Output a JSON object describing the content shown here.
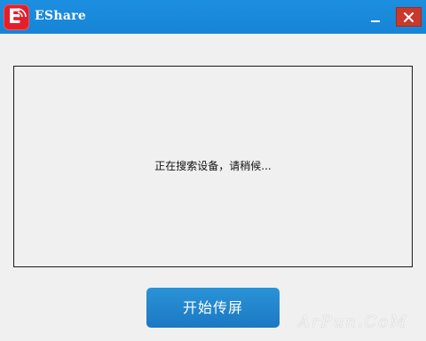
{
  "window": {
    "title": "EShare",
    "app_icon_letter": "E"
  },
  "titlebar": {
    "minimize_icon": "minimize-icon",
    "close_icon": "close-icon"
  },
  "main": {
    "status_text": "正在搜索设备，请稍候..."
  },
  "actions": {
    "start_label": "开始传屏"
  },
  "watermark": {
    "text": "ArPun.CoM"
  },
  "colors": {
    "titlebar": "#1684d6",
    "close_button": "#c8392c",
    "app_icon": "#e41f2a",
    "primary_button": "#1b78c2",
    "window_background": "#f0f0f0"
  }
}
